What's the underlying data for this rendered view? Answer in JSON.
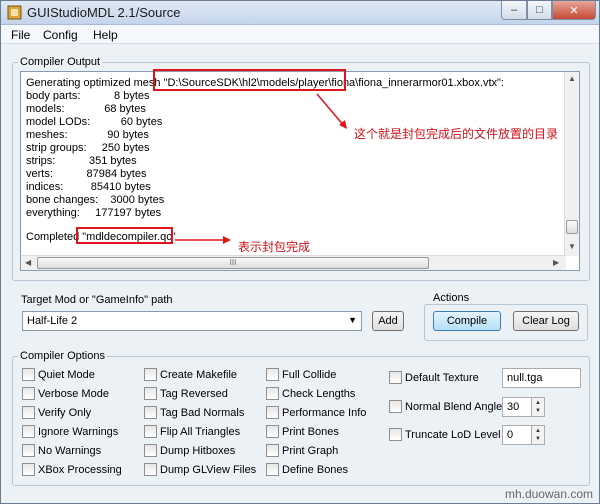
{
  "window": {
    "title": "GUIStudioMDL 2.1/Source"
  },
  "menu": [
    "File",
    "Config",
    "Help"
  ],
  "output": {
    "label": "Compiler Output",
    "lines": [
      "Generating optimized mesh \"D:\\SourceSDK\\hl2\\models/player\\fiona\\fiona_innerarmor01.xbox.vtx\":",
      "body parts:           8 bytes",
      "models:             68 bytes",
      "model LODs:          60 bytes",
      "meshes:             90 bytes",
      "strip groups:     250 bytes",
      "strips:           351 bytes",
      "verts:           87984 bytes",
      "indices:         85410 bytes",
      "bone changes:    3000 bytes",
      "everything:     177197 bytes",
      "",
      "Completed \"mdldecompiler.qc\""
    ],
    "scroll_thumb_label": "III"
  },
  "annotations": {
    "directory_note": "这个就是封包完成后的文件放置的目录",
    "complete_note": "表示封包完成"
  },
  "target": {
    "label": "Target Mod or \"GameInfo\" path",
    "value": "Half-Life 2",
    "add_label": "Add"
  },
  "actions": {
    "label": "Actions",
    "compile_label": "Compile",
    "clear_label": "Clear Log"
  },
  "options": {
    "label": "Compiler Options",
    "col1": [
      "Quiet Mode",
      "Verbose Mode",
      "Verify Only",
      "Ignore Warnings",
      "No Warnings",
      "XBox Processing"
    ],
    "col2": [
      "Create Makefile",
      "Tag Reversed",
      "Tag Bad Normals",
      "Flip All Triangles",
      "Dump Hitboxes",
      "Dump GLView Files"
    ],
    "col3": [
      "Full Collide",
      "Check Lengths",
      "Performance Info",
      "Print Bones",
      "Print Graph",
      "Define Bones"
    ],
    "default_texture_label": "Default Texture",
    "default_texture_value": "null.tga",
    "blend_angle_label": "Normal Blend Angle",
    "blend_angle_value": "30",
    "lod_label": "Truncate LoD Level",
    "lod_value": "0"
  },
  "watermark": "mh.duowan.com"
}
